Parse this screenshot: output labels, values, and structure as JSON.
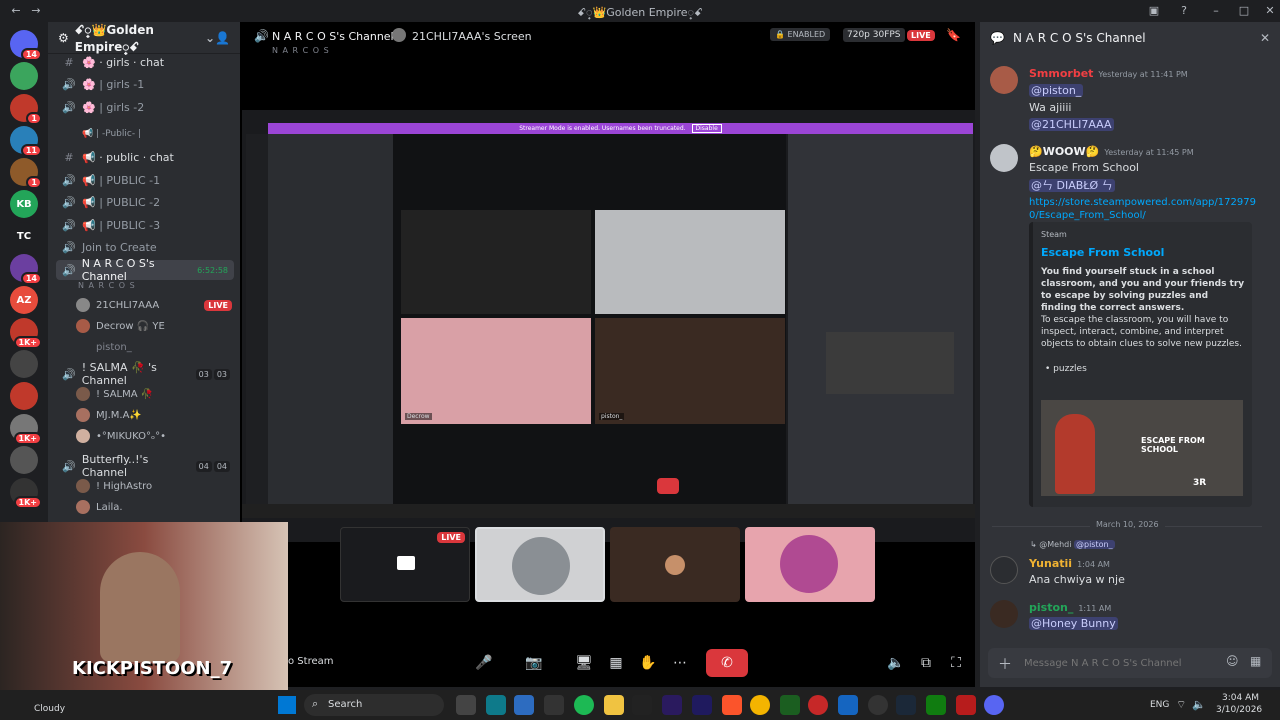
{
  "window": {
    "title": "ꗃ꫶👑Golden Empire꫶ꗃ"
  },
  "servers": [
    {
      "label": "",
      "color": "#5865f2",
      "badge": "14"
    },
    {
      "label": "",
      "color": "#3ba55d",
      "badge": ""
    },
    {
      "label": "",
      "color": "#c0392b",
      "badge": "1"
    },
    {
      "label": "",
      "color": "#2980b9",
      "badge": "11"
    },
    {
      "label": "",
      "color": "#8e5a2a",
      "badge": "1"
    },
    {
      "label": "KB",
      "color": "#23a559",
      "badge": ""
    },
    {
      "label": "TC",
      "color": "#1e1f22",
      "badge": ""
    },
    {
      "label": "",
      "color": "#6b3fa0",
      "badge": "14"
    },
    {
      "label": "AZ",
      "color": "#e74c3c",
      "badge": ""
    },
    {
      "label": "",
      "color": "#c0392b",
      "badge": "1K+"
    },
    {
      "label": "",
      "color": "#444",
      "badge": ""
    },
    {
      "label": "",
      "color": "#c0392b",
      "badge": ""
    },
    {
      "label": "",
      "color": "#777",
      "badge": "1K+"
    },
    {
      "label": "",
      "color": "#555",
      "badge": ""
    },
    {
      "label": "",
      "color": "#333",
      "badge": "1K+"
    }
  ],
  "guild": {
    "name": "ꗃ꫶👑Golden Empire꫶ꗃ"
  },
  "channels": [
    {
      "name": "🌸 · girls · chat",
      "icon": "#",
      "type": "text"
    },
    {
      "name": "🌸 | girls -1",
      "icon": "🔊",
      "type": "voice"
    },
    {
      "name": "🌸 | girls -2",
      "icon": "🔊",
      "type": "voice"
    },
    {
      "name": "📢 | -Public- |",
      "icon": "",
      "type": "category"
    },
    {
      "name": "📢 · public · chat",
      "icon": "#",
      "type": "text"
    },
    {
      "name": "📢 | PUBLIC -1",
      "icon": "🔊",
      "type": "voice"
    },
    {
      "name": "📢 | PUBLIC -2",
      "icon": "🔊",
      "type": "voice"
    },
    {
      "name": "📢 | PUBLIC -3",
      "icon": "🔊",
      "type": "voice"
    },
    {
      "name": "Join to Create",
      "icon": "🔊",
      "type": "voice"
    },
    {
      "name": "N A R C O S's Channel",
      "icon": "🔊",
      "type": "active",
      "timer": "6:52:58",
      "status": "N A R C O S"
    }
  ],
  "voice_users": [
    {
      "name": "21CHLI7AAA",
      "live": "LIVE"
    },
    {
      "name": "Decrow 🎧 YE",
      "live": ""
    },
    {
      "name": "piston_",
      "live": ""
    }
  ],
  "salma": {
    "name": "! SALMA 🥀 's Channel",
    "count_a": "03",
    "count_b": "03",
    "users": [
      "! SALMA 🥀",
      "MJ.M.A✨",
      "•°MIKUKO°ₒ°•"
    ]
  },
  "butterfly": {
    "name": "Butterfly..!'s Channel",
    "count_a": "04",
    "count_b": "04",
    "users": [
      "! HighAstro",
      "Laila."
    ]
  },
  "topbar": {
    "channel": "N A R C O S's Channel",
    "sub": "N A R C O S",
    "screen": "21CHLI7AAA's Screen",
    "enabled": "ENABLED",
    "quality": "720p 30FPS",
    "live": "LIVE"
  },
  "inner_stream": {
    "banner": "Streamer Mode is enabled. Usernames been truncated.",
    "banner_btn": "Disable",
    "tiles": [
      {
        "label": ""
      },
      {
        "label": ""
      },
      {
        "label": "Decrow"
      },
      {
        "label": "piston_"
      }
    ]
  },
  "controls": {
    "stream_label": "o Stream"
  },
  "panel": {
    "title": "N A R C O S's Channel",
    "messages": [
      {
        "name": "Smmorbet",
        "color": "#f23f43",
        "time": "Yesterday at 11:41 PM",
        "lines": [
          "@piston_",
          "Wa ajiiii",
          "@21CHLI7AAA"
        ]
      },
      {
        "name": "🤔WOOW🤔",
        "color": "#f2f3f5",
        "time": "Yesterday at 11:45 PM",
        "lines": [
          "Escape From School",
          "@ㄣ DIABŁØ ㄣ",
          "https://store.steampowered.com/app/1729790/Escape_From_School/"
        ]
      }
    ],
    "embed": {
      "provider": "Steam",
      "title": "Escape From School",
      "desc": "You find yourself stuck in a school classroom, and you and your friends try to escape by solving puzzles and finding the correct answers.",
      "desc2": "To escape the classroom, you will have to inspect, interact, combine, and interpret objects to obtain clues to solve new puzzles.",
      "bullet": "puzzles",
      "image_text": "ESCAPE FROM SCHOOL",
      "image_logo": "3R"
    },
    "date_divider": "March 10, 2026",
    "reply": {
      "mention": "@Mehdi",
      "target": "@piston_",
      "name": "Yunatii",
      "time": "1:04 AM",
      "text": "Ana chwiya w nje"
    },
    "last": {
      "name": "piston_",
      "time": "1:11 AM",
      "text": "@Honey Bunny"
    },
    "input_placeholder": "Message N A R C O S's Channel"
  },
  "webcam": {
    "overlay": "KICKPISTOON_7"
  },
  "taskbar": {
    "weather": "Cloudy",
    "search": "Search",
    "lang": "ENG",
    "time": "3:04 AM",
    "date": "3/10/2026"
  },
  "colors": {
    "accent": "#5865f2",
    "live": "#da373c",
    "green": "#23a559"
  }
}
